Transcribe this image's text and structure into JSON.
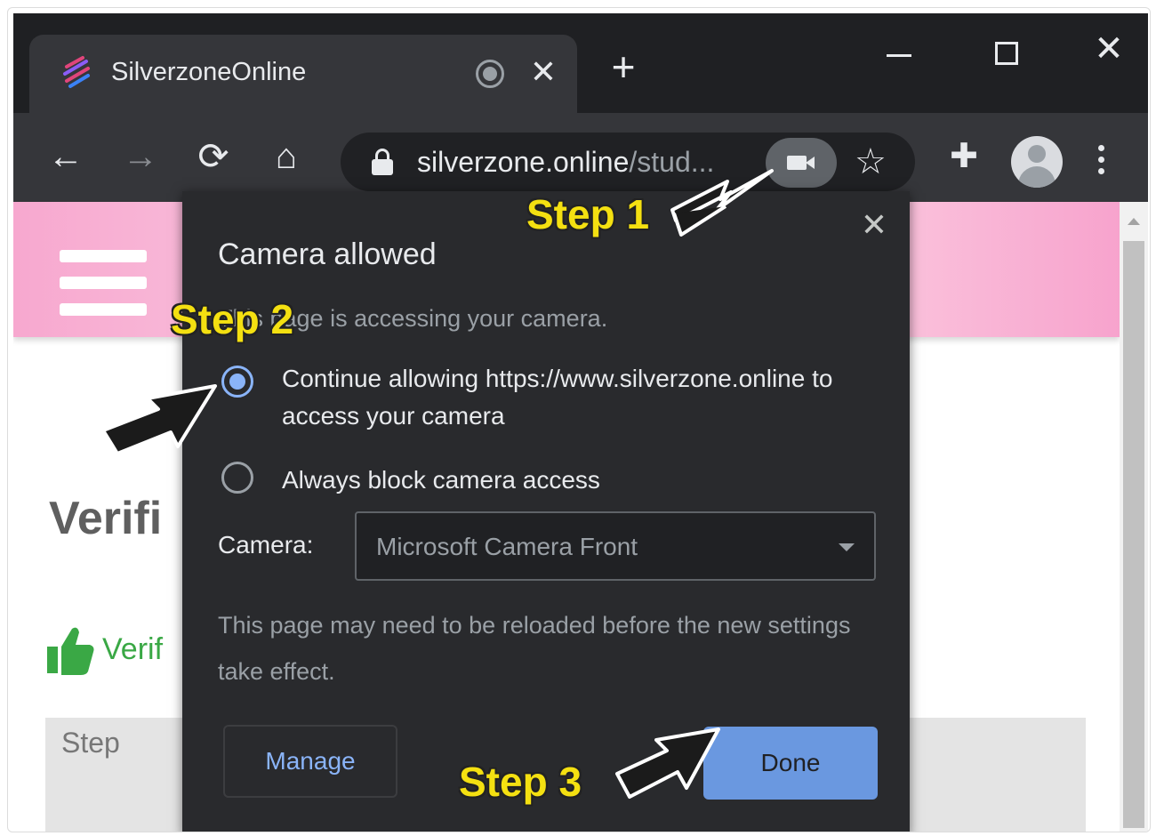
{
  "browser": {
    "tab": {
      "title": "SilverzoneOnline",
      "close_glyph": "✕"
    },
    "new_tab_glyph": "+",
    "window_controls": {
      "close_glyph": "✕"
    },
    "toolbar": {
      "back_glyph": "←",
      "forward_glyph": "→",
      "reload_glyph": "⟳",
      "home_glyph": "⌂",
      "url_host": "silverzone.online",
      "url_path": "/stud...",
      "star_glyph": "☆",
      "extensions_glyph": "✚"
    }
  },
  "page": {
    "heading": "Verifi",
    "verif_text": "Verif",
    "step_box_label": "Step"
  },
  "popup": {
    "close_glyph": "✕",
    "title": "Camera allowed",
    "subtitle": "This page is accessing your camera.",
    "options": [
      {
        "label": "Continue allowing https://www.silverzone.online to access your camera",
        "selected": true
      },
      {
        "label": "Always block camera access",
        "selected": false
      }
    ],
    "camera_label": "Camera:",
    "camera_selected": "Microsoft Camera Front",
    "note": "This page may need to be reloaded before the new settings take effect.",
    "manage_label": "Manage",
    "done_label": "Done"
  },
  "annotations": {
    "step1": "Step 1",
    "step2": "Step 2",
    "step3": "Step 3"
  },
  "colors": {
    "accent_blue": "#8ab4f8",
    "done_button": "#6a98e0",
    "step_yellow": "#f4e011",
    "verified_green": "#3aa845",
    "pink_header": "#f7a8cf"
  }
}
